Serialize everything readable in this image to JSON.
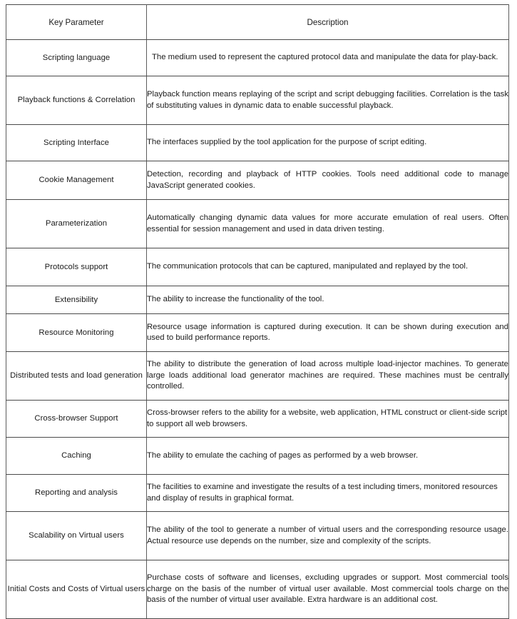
{
  "document": {
    "kind": "specification-table",
    "header": {
      "key_parameter": "Key Parameter",
      "description": "Description"
    },
    "rows": [
      {
        "parameter": "Scripting language",
        "description": "The medium used to represent the captured protocol data and manipulate the data for play-back.",
        "align": "justify",
        "indent": true
      },
      {
        "parameter": "Playback functions & Correlation",
        "description": "Playback function means replaying of the script and script debugging facilities. Correlation is the task of substituting values in dynamic data to enable successful playback.",
        "align": "justify",
        "indent": false
      },
      {
        "parameter": "Scripting Interface",
        "description": "The interfaces supplied by the tool application for the purpose of script editing.",
        "align": "left",
        "indent": false
      },
      {
        "parameter": "Cookie Management",
        "description": "Detection, recording and playback of HTTP cookies. Tools need additional code to manage JavaScript generated cookies.",
        "align": "justify",
        "indent": false
      },
      {
        "parameter": "Parameterization",
        "description": "Automatically changing dynamic data values for more accurate emulation of real users. Often essential for session management and used in data driven testing.",
        "align": "justify",
        "indent": false
      },
      {
        "parameter": "Protocols support",
        "description": "The communication protocols that can be captured, manipulated and replayed by the tool.",
        "align": "justify",
        "indent": false
      },
      {
        "parameter": "Extensibility",
        "description": "The ability to increase the functionality of the tool.",
        "align": "left",
        "indent": false
      },
      {
        "parameter": "Resource Monitoring",
        "description": "Resource usage information is captured during execution. It can be shown during execution and used to build performance reports.",
        "align": "justify",
        "indent": false
      },
      {
        "parameter": "Distributed tests and load generation",
        "description": "The ability to distribute the generation of load across multiple load-injector machines. To generate large loads additional load generator machines are required. These machines must be centrally controlled.",
        "align": "justify",
        "indent": false
      },
      {
        "parameter": "Cross-browser Support",
        "description": "Cross-browser refers to the ability for a website, web application, HTML construct or client-side script to support all web browsers.",
        "align": "left",
        "indent": false
      },
      {
        "parameter": "Caching",
        "description": "The ability to emulate the caching of pages as performed by a web browser.",
        "align": "justify",
        "indent": false
      },
      {
        "parameter": "Reporting and analysis",
        "description": "The facilities to examine and investigate the results of a test including timers, monitored resources and display of results in graphical format.",
        "align": "left",
        "indent": false
      },
      {
        "parameter": "Scalability on Virtual users",
        "description": "The ability of the tool to generate a number of virtual users and the corresponding resource usage. Actual resource use depends on the number, size and complexity of the scripts.",
        "align": "justify",
        "indent": false
      },
      {
        "parameter": "Initial Costs and Costs of Virtual users",
        "description": "Purchase costs of software and licenses, excluding upgrades or support. Most commercial tools charge on the basis of the number of virtual user available. Most commercial tools charge on the basis of the number of virtual user available. Extra hardware is an additional cost.",
        "align": "justify",
        "indent": false
      }
    ]
  },
  "colors": {
    "page_background": "#ffffff",
    "text": "#1b1b1b",
    "outer_border": "#111111",
    "inner_border": "#5d5d5d"
  }
}
